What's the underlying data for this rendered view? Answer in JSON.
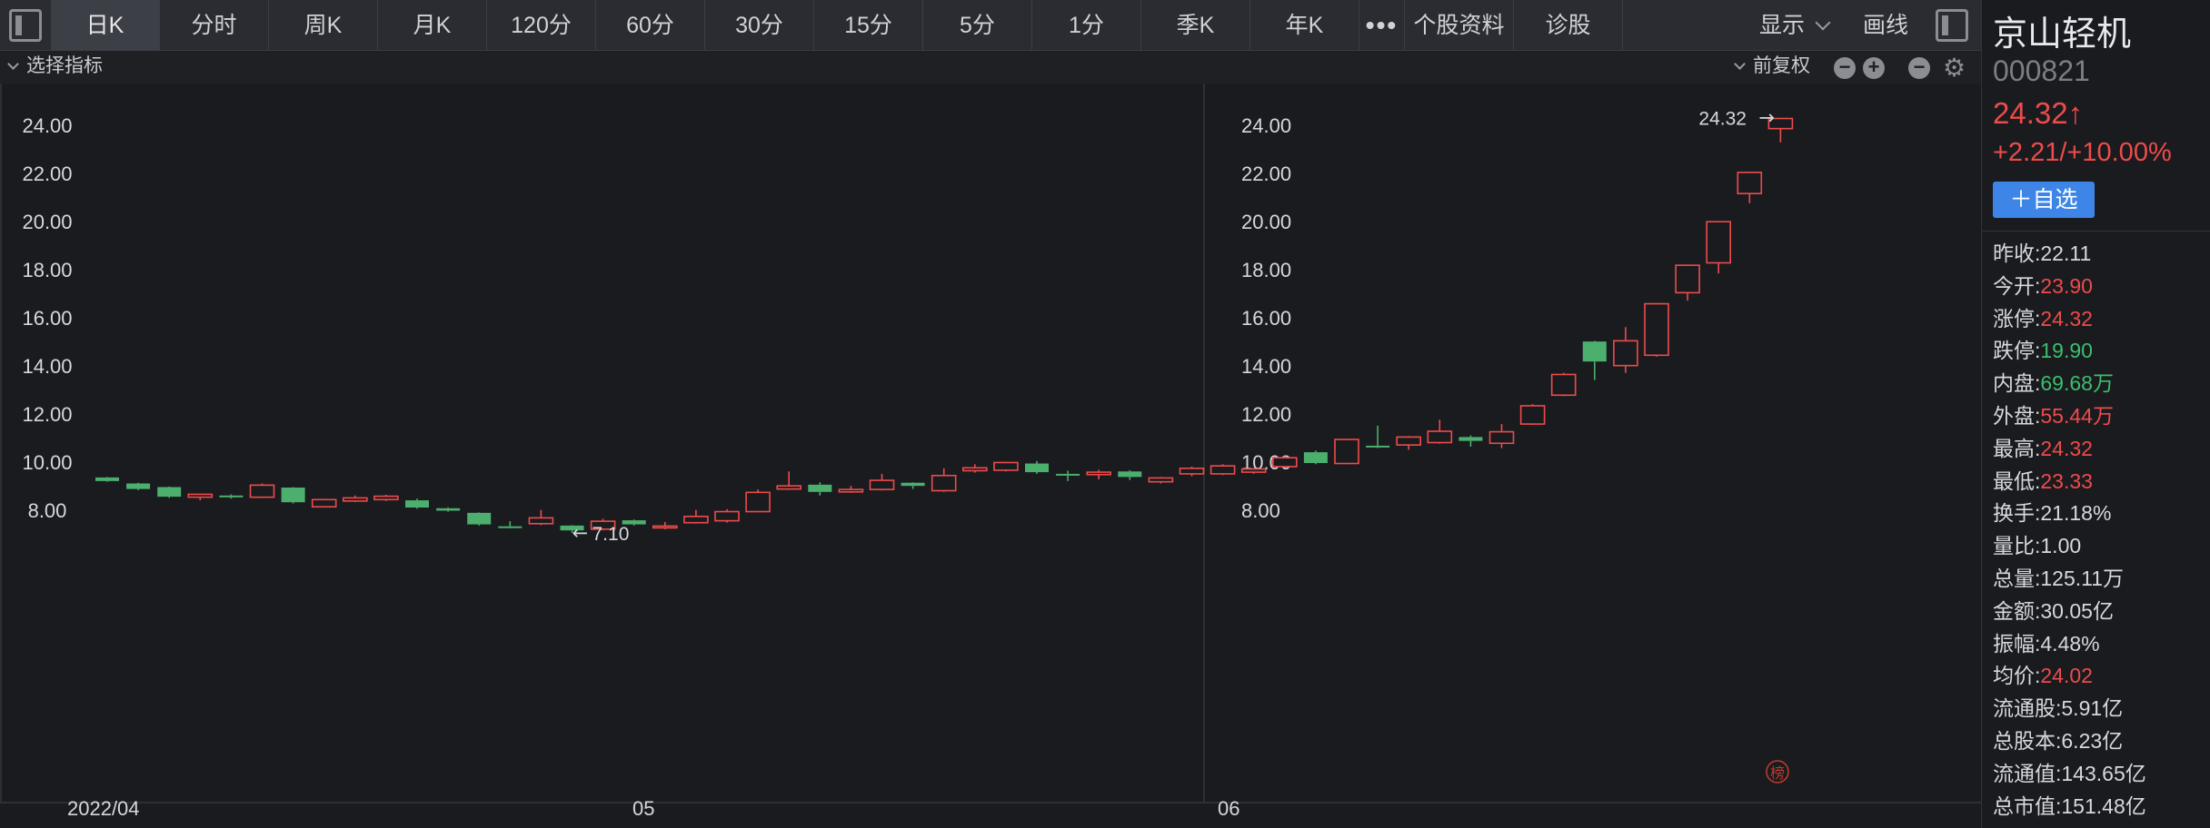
{
  "toolbar": {
    "tabs": [
      "日K",
      "分时",
      "周K",
      "月K",
      "120分",
      "60分",
      "30分",
      "15分",
      "5分",
      "1分",
      "季K",
      "年K",
      "•••",
      "个股资料",
      "诊股"
    ],
    "active_tab": "日K",
    "display_label": "显示",
    "draw_label": "画线"
  },
  "indicator_bar": {
    "select_label": "选择指标",
    "adjust_label": "前复权"
  },
  "chart_data": {
    "type": "candlestick",
    "x_labels": [
      "2022/04",
      "05",
      "06"
    ],
    "ylim": [
      6.8,
      25.2
    ],
    "y_ticks": [
      "24.00",
      "22.00",
      "20.00",
      "18.00",
      "16.00",
      "14.00",
      "12.00",
      "10.00",
      "8.00"
    ],
    "max_label": "24.32",
    "min_label": "7.10",
    "badge": "榜",
    "candles": [
      {
        "o": 9.4,
        "h": 9.42,
        "l": 9.22,
        "c": 9.25
      },
      {
        "o": 9.15,
        "h": 9.18,
        "l": 8.87,
        "c": 8.92
      },
      {
        "o": 9.0,
        "h": 9.02,
        "l": 8.55,
        "c": 8.6
      },
      {
        "o": 8.58,
        "h": 8.72,
        "l": 8.45,
        "c": 8.7
      },
      {
        "o": 8.65,
        "h": 8.7,
        "l": 8.52,
        "c": 8.58
      },
      {
        "o": 8.58,
        "h": 9.15,
        "l": 8.55,
        "c": 9.08
      },
      {
        "o": 8.98,
        "h": 9.0,
        "l": 8.32,
        "c": 8.37
      },
      {
        "o": 8.18,
        "h": 8.5,
        "l": 8.15,
        "c": 8.48
      },
      {
        "o": 8.42,
        "h": 8.65,
        "l": 8.38,
        "c": 8.55
      },
      {
        "o": 8.48,
        "h": 8.68,
        "l": 8.42,
        "c": 8.62
      },
      {
        "o": 8.45,
        "h": 8.52,
        "l": 8.1,
        "c": 8.15
      },
      {
        "o": 8.12,
        "h": 8.16,
        "l": 7.98,
        "c": 8.02
      },
      {
        "o": 7.93,
        "h": 7.95,
        "l": 7.4,
        "c": 7.45
      },
      {
        "o": 7.37,
        "h": 7.58,
        "l": 7.28,
        "c": 7.32
      },
      {
        "o": 7.48,
        "h": 8.05,
        "l": 7.42,
        "c": 7.72
      },
      {
        "o": 7.4,
        "h": 7.42,
        "l": 7.1,
        "c": 7.2
      },
      {
        "o": 7.25,
        "h": 7.68,
        "l": 7.2,
        "c": 7.58
      },
      {
        "o": 7.62,
        "h": 7.65,
        "l": 7.4,
        "c": 7.45
      },
      {
        "o": 7.32,
        "h": 7.55,
        "l": 7.25,
        "c": 7.38
      },
      {
        "o": 7.52,
        "h": 8.05,
        "l": 7.48,
        "c": 7.78
      },
      {
        "o": 7.6,
        "h": 8.08,
        "l": 7.52,
        "c": 7.98
      },
      {
        "o": 7.98,
        "h": 8.9,
        "l": 7.95,
        "c": 8.78
      },
      {
        "o": 8.92,
        "h": 9.65,
        "l": 8.88,
        "c": 9.05
      },
      {
        "o": 9.1,
        "h": 9.2,
        "l": 8.65,
        "c": 8.8
      },
      {
        "o": 8.8,
        "h": 9.05,
        "l": 8.76,
        "c": 8.9
      },
      {
        "o": 8.9,
        "h": 9.55,
        "l": 8.86,
        "c": 9.28
      },
      {
        "o": 9.18,
        "h": 9.2,
        "l": 8.92,
        "c": 9.05
      },
      {
        "o": 8.85,
        "h": 9.78,
        "l": 8.8,
        "c": 9.48
      },
      {
        "o": 9.68,
        "h": 9.95,
        "l": 9.6,
        "c": 9.8
      },
      {
        "o": 9.7,
        "h": 10.05,
        "l": 9.65,
        "c": 10.02
      },
      {
        "o": 9.98,
        "h": 10.08,
        "l": 9.55,
        "c": 9.62
      },
      {
        "o": 9.55,
        "h": 9.68,
        "l": 9.25,
        "c": 9.52
      },
      {
        "o": 9.52,
        "h": 9.72,
        "l": 9.32,
        "c": 9.62
      },
      {
        "o": 9.65,
        "h": 9.7,
        "l": 9.3,
        "c": 9.42
      },
      {
        "o": 9.22,
        "h": 9.42,
        "l": 9.15,
        "c": 9.38
      },
      {
        "o": 9.55,
        "h": 9.85,
        "l": 9.45,
        "c": 9.78
      },
      {
        "o": 9.55,
        "h": 9.95,
        "l": 9.5,
        "c": 9.88
      },
      {
        "o": 9.62,
        "h": 9.8,
        "l": 9.55,
        "c": 9.75
      },
      {
        "o": 9.85,
        "h": 10.28,
        "l": 9.82,
        "c": 10.22
      },
      {
        "o": 10.45,
        "h": 10.52,
        "l": 9.95,
        "c": 10.0
      },
      {
        "o": 9.98,
        "h": 11.0,
        "l": 9.95,
        "c": 10.98
      },
      {
        "o": 10.72,
        "h": 11.55,
        "l": 10.62,
        "c": 10.65
      },
      {
        "o": 10.75,
        "h": 11.12,
        "l": 10.55,
        "c": 11.08
      },
      {
        "o": 10.85,
        "h": 11.8,
        "l": 10.8,
        "c": 11.32
      },
      {
        "o": 11.08,
        "h": 11.15,
        "l": 10.68,
        "c": 10.92
      },
      {
        "o": 10.82,
        "h": 11.62,
        "l": 10.62,
        "c": 11.3
      },
      {
        "o": 11.62,
        "h": 12.45,
        "l": 11.58,
        "c": 12.38
      },
      {
        "o": 12.82,
        "h": 13.75,
        "l": 12.78,
        "c": 13.68
      },
      {
        "o": 15.05,
        "h": 15.08,
        "l": 13.45,
        "c": 14.22
      },
      {
        "o": 14.05,
        "h": 15.65,
        "l": 13.75,
        "c": 15.08
      },
      {
        "o": 14.48,
        "h": 16.65,
        "l": 14.42,
        "c": 16.62
      },
      {
        "o": 17.08,
        "h": 18.25,
        "l": 16.75,
        "c": 18.22
      },
      {
        "o": 18.32,
        "h": 20.05,
        "l": 17.88,
        "c": 20.03
      },
      {
        "o": 21.2,
        "h": 22.1,
        "l": 20.8,
        "c": 22.08
      },
      {
        "o": 23.9,
        "h": 24.32,
        "l": 23.33,
        "c": 24.32
      }
    ]
  },
  "quote": {
    "name": "京山轻机",
    "code": "000821",
    "price": "24.32↑",
    "change": "+2.21/+10.00%",
    "watch_button": "＋自选",
    "stats": [
      {
        "label": "昨收:",
        "value": "22.11",
        "color": "white"
      },
      {
        "label": "今开:",
        "value": "23.90",
        "color": "red"
      },
      {
        "label": "涨停:",
        "value": "24.32",
        "color": "red"
      },
      {
        "label": "跌停:",
        "value": "19.90",
        "color": "green"
      },
      {
        "label": "内盘:",
        "value": "69.68万",
        "color": "green"
      },
      {
        "label": "外盘:",
        "value": "55.44万",
        "color": "red"
      },
      {
        "label": "最高:",
        "value": "24.32",
        "color": "red"
      },
      {
        "label": "最低:",
        "value": "23.33",
        "color": "red"
      },
      {
        "label": "换手:",
        "value": "21.18%",
        "color": "white"
      },
      {
        "label": "量比:",
        "value": "1.00",
        "color": "white"
      },
      {
        "label": "总量:",
        "value": "125.11万",
        "color": "white"
      },
      {
        "label": "金额:",
        "value": "30.05亿",
        "color": "white"
      },
      {
        "label": "振幅:",
        "value": "4.48%",
        "color": "white"
      },
      {
        "label": "均价:",
        "value": "24.02",
        "color": "red"
      },
      {
        "label": "流通股:",
        "value": "5.91亿",
        "color": "white"
      },
      {
        "label": "总股本:",
        "value": "6.23亿",
        "color": "white"
      },
      {
        "label": "流通值:",
        "value": "143.65亿",
        "color": "white"
      },
      {
        "label": "总市值:",
        "value": "151.48亿",
        "color": "white"
      }
    ]
  },
  "colors": {
    "up": "#ee4b4b",
    "down": "#4caf6e",
    "bg": "#1a1b1f",
    "grid": "#2a2b30"
  }
}
